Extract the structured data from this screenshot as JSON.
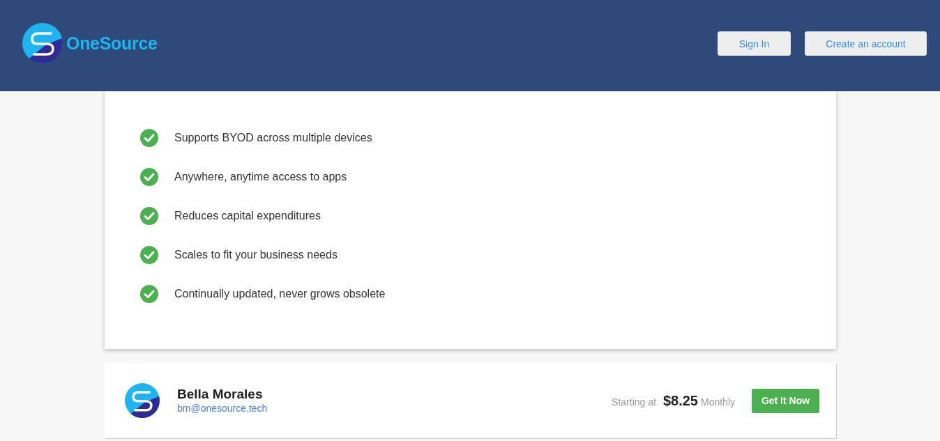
{
  "header": {
    "brand": "OneSource",
    "buttons": [
      {
        "label": "Sign In"
      },
      {
        "label": "Create an account"
      }
    ]
  },
  "features": [
    {
      "text": "Supports BYOD across multiple devices"
    },
    {
      "text": "Anywhere, anytime access to apps"
    },
    {
      "text": "Reduces capital expenditures"
    },
    {
      "text": "Scales to fit your business needs"
    },
    {
      "text": "Continually updated, never grows obsolete"
    }
  ],
  "offer": {
    "name": "Bella Morales",
    "email": "bm@onesource.tech",
    "price_prefix": "Starting at",
    "price": "$8.25",
    "period": "Monthly",
    "button": "Get It Now"
  }
}
